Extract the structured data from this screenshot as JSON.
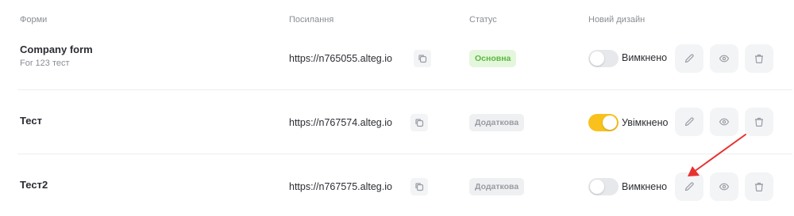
{
  "columns": {
    "forms": "Форми",
    "link": "Посилання",
    "status": "Статус",
    "new_design": "Новий дизайн"
  },
  "rows": [
    {
      "name": "Company form",
      "subtitle": "For 123 тест",
      "link": "https://n765055.alteg.io",
      "status": "Основна",
      "status_type": "primary",
      "design_enabled": false,
      "design_label": "Вимкнено"
    },
    {
      "name": "Тест",
      "subtitle": "",
      "link": "https://n767574.alteg.io",
      "status": "Додаткова",
      "status_type": "secondary",
      "design_enabled": true,
      "design_label": "Увімкнено"
    },
    {
      "name": "Тест2",
      "subtitle": "",
      "link": "https://n767575.alteg.io",
      "status": "Додаткова",
      "status_type": "secondary",
      "design_enabled": false,
      "design_label": "Вимкнено"
    }
  ],
  "icons": {
    "copy": "copy-icon",
    "edit": "pencil-icon",
    "view": "eye-icon",
    "delete": "trash-icon"
  },
  "colors": {
    "toggle_on": "#f8c11c",
    "primary_badge_bg": "#e4f7dd",
    "primary_badge_text": "#5bb83b",
    "annotation_arrow": "#e8312f"
  }
}
